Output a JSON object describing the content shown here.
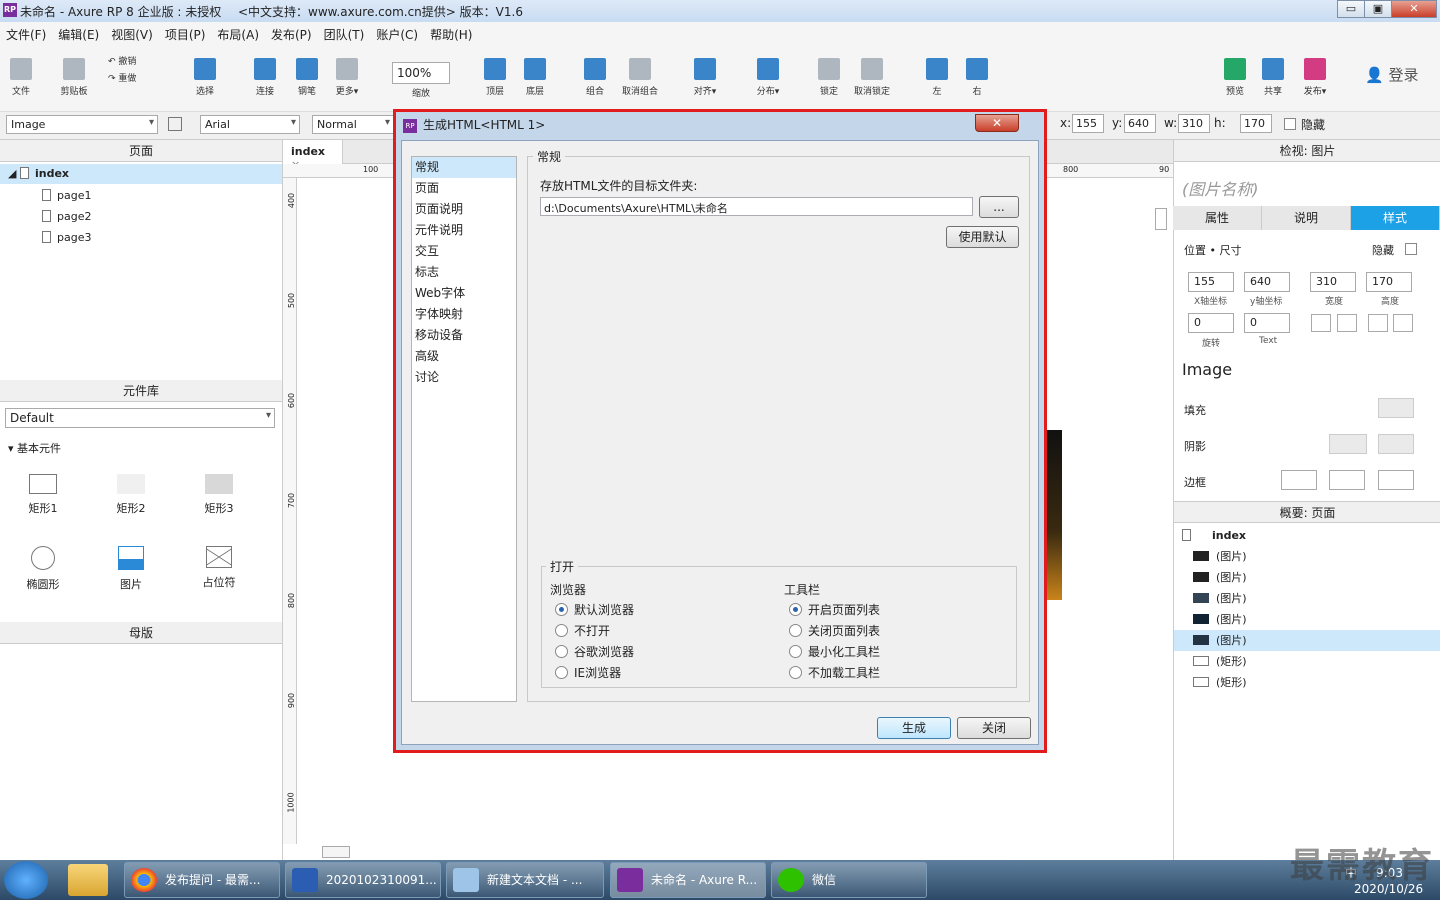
{
  "window": {
    "title": "未命名 - Axure RP 8 企业版 : 未授权",
    "support": "<中文支持：www.axure.com.cn提供> 版本：V1.6",
    "min": "▭",
    "max": "▣",
    "close": "✕",
    "logo": "RP"
  },
  "menu": [
    "文件(F)",
    "编辑(E)",
    "视图(V)",
    "项目(P)",
    "布局(A)",
    "发布(P)",
    "团队(T)",
    "账户(C)",
    "帮助(H)"
  ],
  "toolbar": {
    "file": "文件",
    "clipboard": "剪贴板",
    "undo": "撤销",
    "redo": "重做",
    "select": "选择",
    "connect": "连接",
    "pen": "钢笔",
    "more": "更多▾",
    "zoom": "100%",
    "zoom_label": "缩放",
    "top": "顶层",
    "bottom": "底层",
    "group": "组合",
    "ungroup": "取消组合",
    "align": "对齐▾",
    "distribute": "分布▾",
    "lock": "锁定",
    "unlock": "取消锁定",
    "left": "左",
    "right": "右",
    "preview": "预览",
    "share": "共享",
    "publish": "发布▾",
    "login": "登录"
  },
  "propbar": {
    "widget": "Image",
    "font": "Arial",
    "style": "Normal",
    "x_label": "x:",
    "x": "155",
    "y_label": "y:",
    "y": "640",
    "w_label": "w:",
    "w": "310",
    "h_label": "h:",
    "h": "170",
    "hidden": "隐藏"
  },
  "pages": {
    "title": "页面",
    "root": "index",
    "children": [
      "page1",
      "page2",
      "page3"
    ]
  },
  "library": {
    "title": "元件库",
    "selected": "Default",
    "group": "基本元件",
    "widgets": [
      "矩形1",
      "矩形2",
      "矩形3",
      "椭圆形",
      "图片",
      "占位符"
    ]
  },
  "masters": {
    "title": "母版"
  },
  "canvas": {
    "tab": "index",
    "tab_close": "×",
    "ruler_top": [
      "100",
      "800",
      "90"
    ],
    "ruler_left": [
      "400",
      "500",
      "600",
      "700",
      "800",
      "900",
      "1000"
    ]
  },
  "inspector": {
    "title": "检视: 图片",
    "name_placeholder": "(图片名称)",
    "tabs": [
      "属性",
      "说明",
      "样式"
    ],
    "pos_size": "位置 • 尺寸",
    "hidden": "隐藏",
    "x": "155",
    "y": "640",
    "w": "310",
    "h": "170",
    "x_label": "X轴坐标",
    "y_label": "y轴坐标",
    "w_label": "宽度",
    "h_label": "高度",
    "rotate": "0",
    "rotate_label": "旋转",
    "text_rotate": "0",
    "text_label": "Text",
    "style_name": "Image",
    "fill": "填充",
    "shadow": "阴影",
    "border": "边框"
  },
  "outline": {
    "title": "概要: 页面",
    "root": "index",
    "items": [
      "(图片)",
      "(图片)",
      "(图片)",
      "(图片)",
      "(图片)",
      "(矩形)",
      "(矩形)"
    ]
  },
  "dialog": {
    "title": "生成HTML<HTML 1>",
    "nav": [
      "常规",
      "页面",
      "页面说明",
      "元件说明",
      "交互",
      "标志",
      "Web字体",
      "字体映射",
      "移动设备",
      "高级",
      "讨论"
    ],
    "section": "常规",
    "folder_label": "存放HTML文件的目标文件夹:",
    "folder_path": "d:\\Documents\\Axure\\HTML\\未命名",
    "browse": "...",
    "use_default": "使用默认",
    "open_group": "打开",
    "browser_label": "浏览器",
    "browsers": [
      "默认浏览器",
      "不打开",
      "谷歌浏览器",
      "IE浏览器"
    ],
    "toolbar_label": "工具栏",
    "toolbars": [
      "开启页面列表",
      "关闭页面列表",
      "最小化工具栏",
      "不加载工具栏"
    ],
    "generate": "生成",
    "close": "关闭"
  },
  "taskbar": {
    "items": [
      "发布提问 - 最需...",
      "2020102310091...",
      "新建文本文档 - ...",
      "未命名 - Axure R...",
      "微信"
    ],
    "time": "9:03",
    "date": "2020/10/26",
    "ime": "中"
  },
  "watermark": "最需教育"
}
